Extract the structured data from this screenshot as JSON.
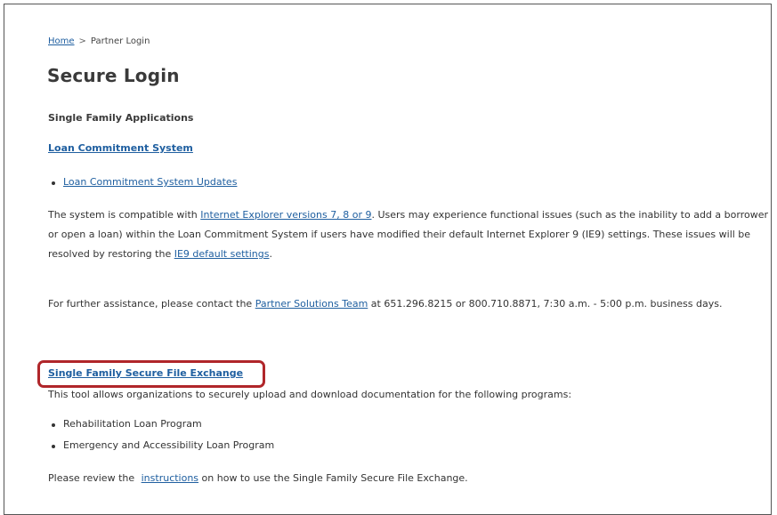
{
  "breadcrumb": {
    "home": "Home",
    "separator": ">",
    "current": "Partner Login"
  },
  "page_title": "Secure Login",
  "section_title": "Single Family Applications",
  "loan_commitment": {
    "link": "Loan Commitment System",
    "updates_link": "Loan Commitment System Updates"
  },
  "compat": {
    "text_1": "The system is compatible with ",
    "ie_link": "Internet Explorer versions 7, 8 or 9",
    "text_2": ".  Users may experience functional issues (such as the inability to add a borrower or open a loan) within the Loan Commitment System if users have modified their default Internet Explorer 9 (IE9) settings.  These issues will be resolved by restoring the ",
    "ie9_link": "IE9 default settings",
    "text_3": "."
  },
  "assistance": {
    "text_1": "For further assistance, please contact the ",
    "team_link": "Partner Solutions Team",
    "text_2": " at 651.296.8215 or 800.710.8871, 7:30 a.m. - 5:00 p.m. business days."
  },
  "file_exchange": {
    "link": "Single Family Secure File Exchange",
    "description": "This tool allows organizations to securely upload and download documentation for the following programs:",
    "programs": [
      "Rehabilitation Loan Program",
      "Emergency and Accessibility Loan Program"
    ],
    "review_text_1": "Please review the ",
    "instructions_link": "instructions",
    "review_text_2": " on how to use the Single Family Secure File Exchange."
  },
  "colors": {
    "link": "#1f5fa0",
    "highlight_box": "#b0262a",
    "text": "#333333"
  }
}
